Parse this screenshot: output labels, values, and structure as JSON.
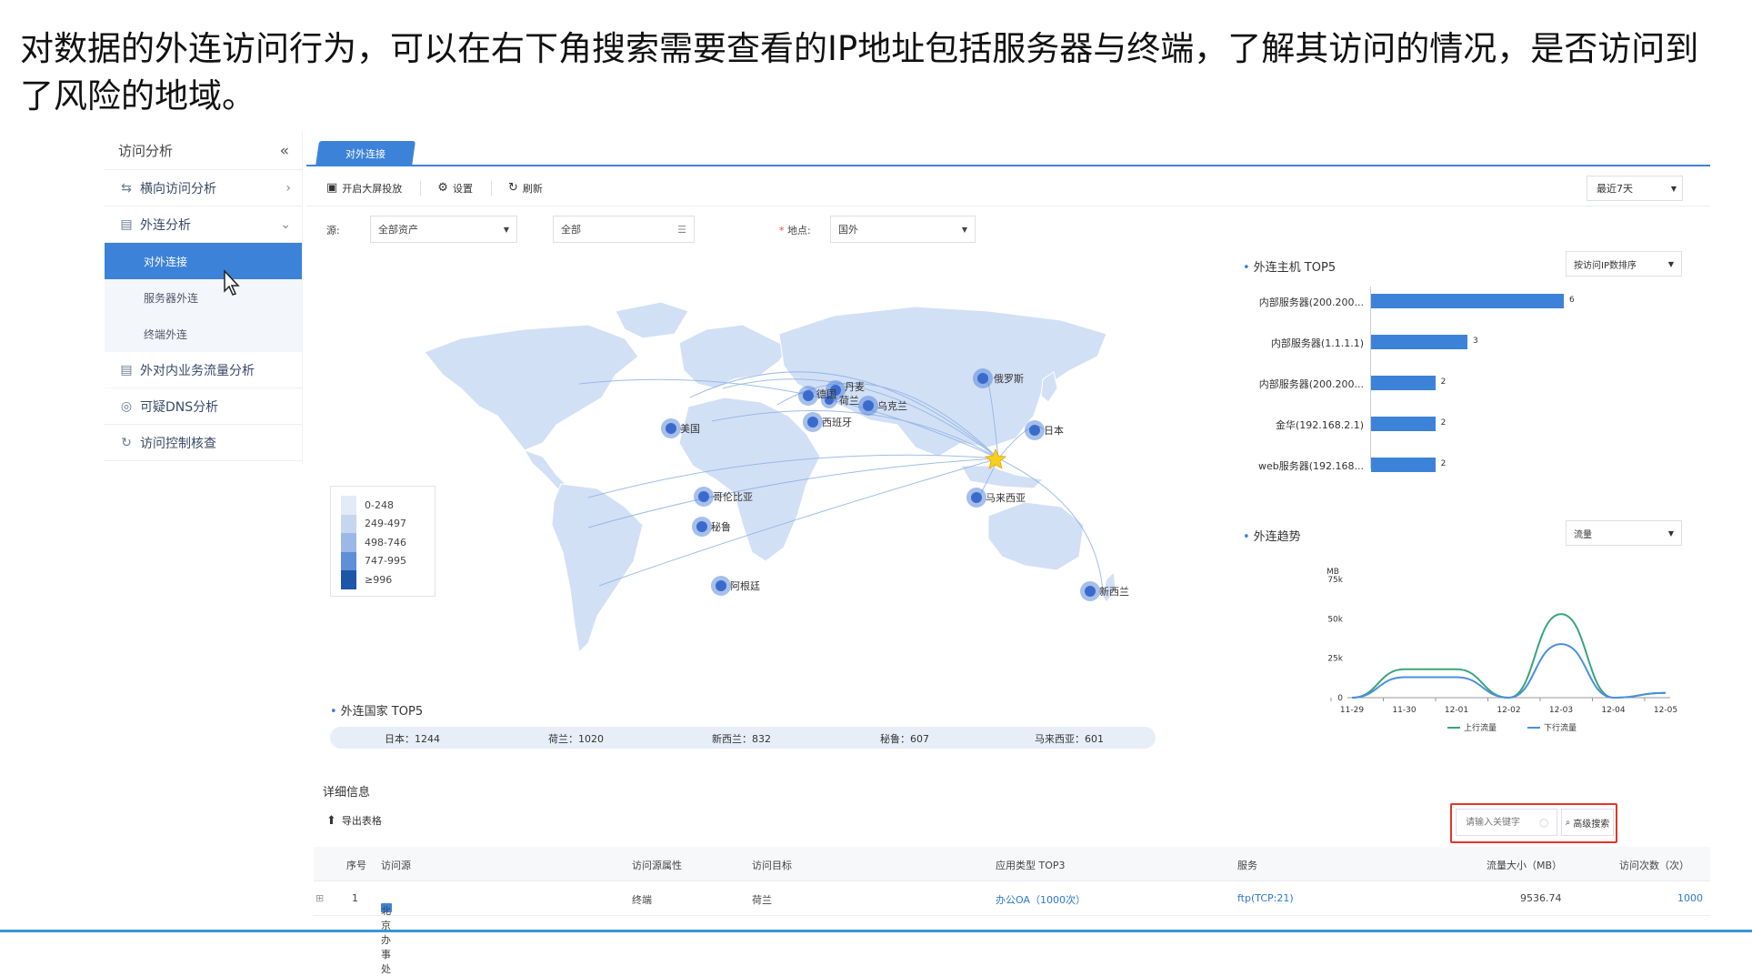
{
  "caption": "对数据的外连访问行为，可以在右下角搜索需要查看的IP地址包括服务器与终端，了解其访问的情况，是否访问到了风险的地域。",
  "sidebar": {
    "title": "访问分析",
    "collapse_icon": "«",
    "items": [
      {
        "label": "横向访问分析",
        "icon": "arrows-icon"
      },
      {
        "label": "外连分析",
        "icon": "doc-icon"
      },
      {
        "label": "外对内业务流量分析",
        "icon": "doc-icon"
      },
      {
        "label": "可疑DNS分析",
        "icon": "dns-icon"
      },
      {
        "label": "访问控制核查",
        "icon": "refresh-icon"
      }
    ],
    "sub_items": [
      "对外连接",
      "服务器外连",
      "终端外连"
    ]
  },
  "tab": {
    "label": "对外连接"
  },
  "toolbar": {
    "fullscreen": "开启大屏投放",
    "settings": "设置",
    "refresh": "刷新",
    "range": "最近7天"
  },
  "filters": {
    "source_label": "源:",
    "source_value": "全部资产",
    "asset_value": "全部",
    "location_label": "地点:",
    "location_value": "国外"
  },
  "map": {
    "legend": [
      {
        "label": "0-248",
        "color": "#e3ebf8"
      },
      {
        "label": "249-497",
        "color": "#c6d6f0"
      },
      {
        "label": "498-746",
        "color": "#9db8e6"
      },
      {
        "label": "747-995",
        "color": "#5f8fd6"
      },
      {
        "label": "≥996",
        "color": "#1c56a8"
      }
    ],
    "cities": [
      "俄罗斯",
      "丹麦",
      "德国",
      "荷兰",
      "乌克兰",
      "西班牙",
      "美国",
      "日本",
      "哥伦比亚",
      "秘鲁",
      "马来西亚",
      "阿根廷",
      "新西兰"
    ]
  },
  "country_top5": {
    "title": "外连国家 TOP5",
    "items": [
      "日本：1244",
      "荷兰：1020",
      "新西兰：832",
      "秘鲁：607",
      "马来西亚：601"
    ]
  },
  "host_top5": {
    "title": "外连主机 TOP5",
    "sort": "按访问IP数排序",
    "items": [
      {
        "label": "内部服务器(200.200...",
        "value": 6
      },
      {
        "label": "内部服务器(1.1.1.1)",
        "value": 3
      },
      {
        "label": "内部服务器(200.200...",
        "value": 2
      },
      {
        "label": "金华(192.168.2.1)",
        "value": 2
      },
      {
        "label": "web服务器(192.168...",
        "value": 2
      }
    ]
  },
  "trend": {
    "title": "外连趋势",
    "select": "流量",
    "unit": "MB",
    "yticks": [
      "75k",
      "50k",
      "25k",
      "0"
    ],
    "legend": [
      "上行流量",
      "下行流量"
    ]
  },
  "chart_data": {
    "type": "line",
    "x": [
      "11-29",
      "11-30",
      "12-01",
      "12-02",
      "12-03",
      "12-04",
      "12-05"
    ],
    "ylabel": "MB",
    "ylim": [
      0,
      75000
    ],
    "series": [
      {
        "name": "上行流量",
        "values": [
          0,
          18000,
          18000,
          0,
          53000,
          0,
          3000
        ],
        "color": "#3aa57b"
      },
      {
        "name": "下行流量",
        "values": [
          0,
          13000,
          13000,
          0,
          34000,
          0,
          3000
        ],
        "color": "#4a8fe0"
      }
    ]
  },
  "detail": {
    "title": "详细信息",
    "export": "导出表格",
    "search_placeholder": "请输入关键字",
    "advanced_search": "高级搜索",
    "columns": [
      "序号",
      "访问源",
      "访问源属性",
      "访问目标",
      "应用类型 TOP3",
      "服务",
      "流量大小（MB）",
      "访问次数（次）"
    ],
    "rows": [
      {
        "index": "1",
        "source": "北京办事处",
        "attr": "终端",
        "target": "荷兰",
        "app": "办公OA（1000次）",
        "service": "ftp(TCP:21)",
        "size": "9536.74",
        "count": "1000"
      }
    ]
  }
}
